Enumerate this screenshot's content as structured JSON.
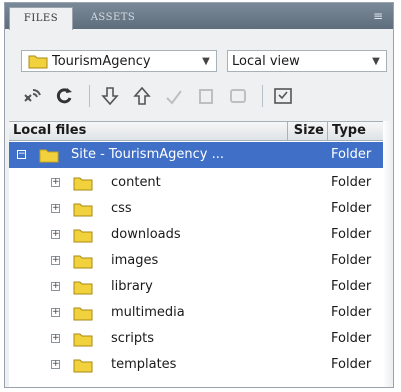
{
  "tabs": {
    "active": "FILES",
    "inactive": "ASSETS"
  },
  "tab_menu_icon": "menu-icon",
  "site_dropdown": {
    "value": "TourismAgency",
    "icon": "folder-icon"
  },
  "view_dropdown": {
    "value": "Local view"
  },
  "toolbar": {
    "buttons": [
      "connect-icon",
      "refresh-icon",
      "get-files-icon",
      "put-files-icon",
      "check-out-icon",
      "check-in-icon",
      "sync-icon",
      "expand-icon"
    ]
  },
  "table": {
    "headers": {
      "name": "Local files",
      "size": "Size",
      "type": "Type"
    },
    "root": {
      "name": "Site - TourismAgency ...",
      "type": "Folder"
    },
    "rows": [
      {
        "name": "content",
        "type": "Folder"
      },
      {
        "name": "css",
        "type": "Folder"
      },
      {
        "name": "downloads",
        "type": "Folder"
      },
      {
        "name": "images",
        "type": "Folder"
      },
      {
        "name": "library",
        "type": "Folder"
      },
      {
        "name": "multimedia",
        "type": "Folder"
      },
      {
        "name": "scripts",
        "type": "Folder"
      },
      {
        "name": "templates",
        "type": "Folder"
      }
    ]
  },
  "colors": {
    "selection": "#3f6fc7",
    "folder": "#f2d23c",
    "tabstrip": "#6b7b89"
  }
}
